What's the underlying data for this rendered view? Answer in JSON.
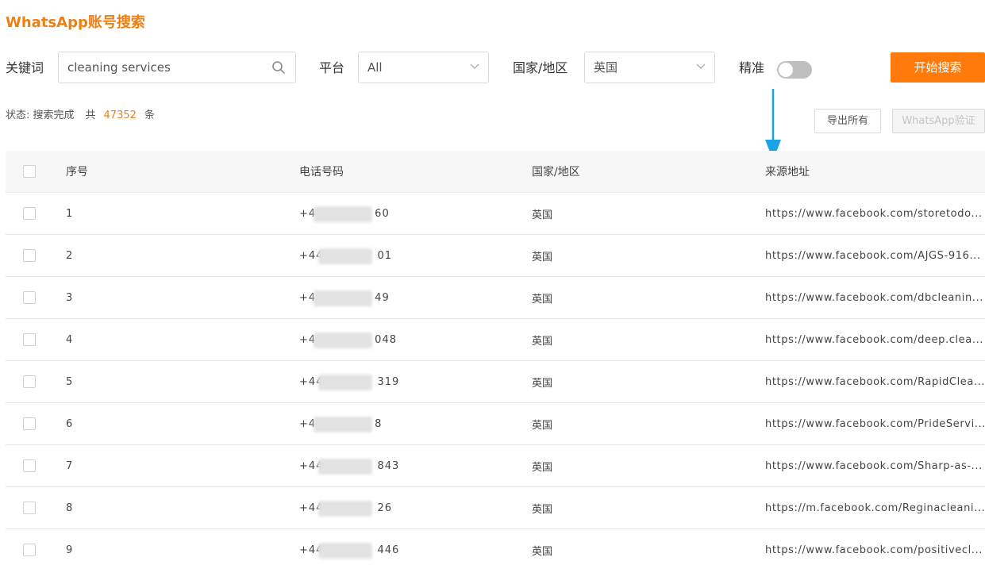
{
  "page": {
    "title": "WhatsApp账号搜索"
  },
  "search": {
    "keyword_label": "关键词",
    "keyword_value": "cleaning services",
    "platform_label": "平台",
    "platform_value": "All",
    "country_label": "国家/地区",
    "country_value": "英国",
    "exact_label": "精准",
    "exact_on": false,
    "start_button": "开始搜索"
  },
  "status": {
    "label": "状态: 搜索完成",
    "total_prefix": "共",
    "total_count": "47352",
    "total_suffix": "条"
  },
  "actions": {
    "export_all": "导出所有",
    "verify": "WhatsApp验证"
  },
  "table": {
    "headers": {
      "index": "序号",
      "phone": "电话号码",
      "country": "国家/地区",
      "source": "来源地址"
    },
    "rows": [
      {
        "index": "1",
        "phone_start": "+4",
        "phone_end": "60",
        "country": "英国",
        "source": "https://www.facebook.com/storetodo..."
      },
      {
        "index": "2",
        "phone_start": "+44",
        "phone_end": "01",
        "country": "英国",
        "source": "https://www.facebook.com/AJGS-916..."
      },
      {
        "index": "3",
        "phone_start": "+4",
        "phone_end": "49",
        "country": "英国",
        "source": "https://www.facebook.com/dbcleanin..."
      },
      {
        "index": "4",
        "phone_start": "+4",
        "phone_end": "048",
        "country": "英国",
        "source": "https://www.facebook.com/deep.clea..."
      },
      {
        "index": "5",
        "phone_start": "+44",
        "phone_end": "319",
        "country": "英国",
        "source": "https://www.facebook.com/RapidClea..."
      },
      {
        "index": "6",
        "phone_start": "+4",
        "phone_end": "8",
        "country": "英国",
        "source": "https://www.facebook.com/PrideServi..."
      },
      {
        "index": "7",
        "phone_start": "+44",
        "phone_end": "843",
        "country": "英国",
        "source": "https://www.facebook.com/Sharp-as-..."
      },
      {
        "index": "8",
        "phone_start": "+44",
        "phone_end": "26",
        "country": "英国",
        "source": "https://m.facebook.com/Reginacleani..."
      },
      {
        "index": "9",
        "phone_start": "+44",
        "phone_end": "446",
        "country": "英国",
        "source": "https://www.facebook.com/positivecl..."
      }
    ]
  },
  "colors": {
    "brand": "#f07f12",
    "primary_button": "#ff7a0a",
    "annotation_arrow": "#1aa3e8"
  },
  "icons": {
    "search": "search-icon",
    "dropdown": "chevron-down-icon",
    "annotation": "arrow-down-icon"
  }
}
